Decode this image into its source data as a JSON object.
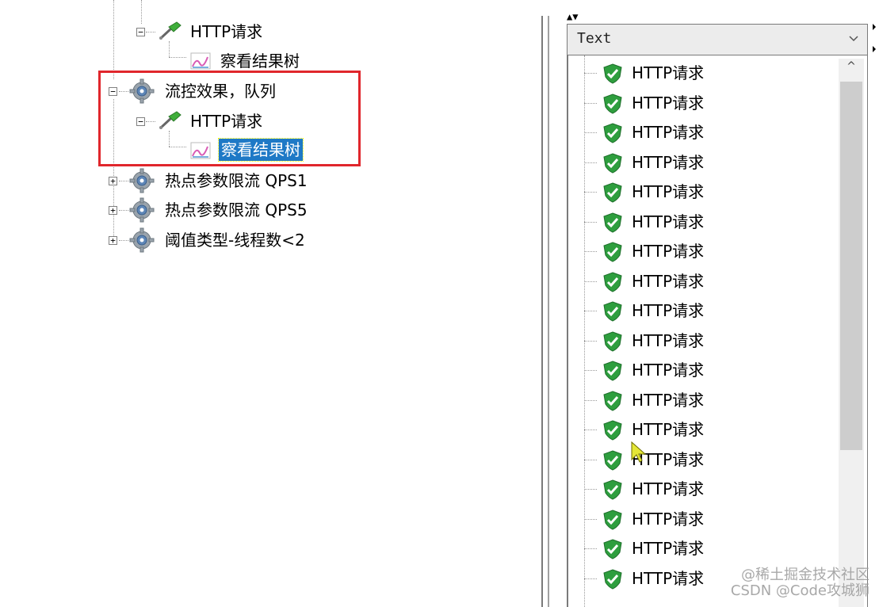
{
  "tree": {
    "nodes": [
      {
        "label": "HTTP请求",
        "type": "sampler",
        "expanded": true
      },
      {
        "label": "察看结果树",
        "type": "listener"
      },
      {
        "label": "流控效果，队列",
        "type": "thread-group",
        "expanded": true
      },
      {
        "label": "HTTP请求",
        "type": "sampler",
        "expanded": true
      },
      {
        "label": "察看结果树",
        "type": "listener",
        "selected": true
      },
      {
        "label": "热点参数限流 QPS1",
        "type": "thread-group",
        "expanded": false
      },
      {
        "label": "热点参数限流 QPS5",
        "type": "thread-group",
        "expanded": false
      },
      {
        "label": "阈值类型-线程数<2",
        "type": "thread-group",
        "expanded": false
      }
    ],
    "toggle_expanded": "−",
    "toggle_collapsed": "+",
    "highlight_color": "#e0262c",
    "selection_color": "#1e79c6"
  },
  "results_panel": {
    "renderer_select": {
      "value": "Text"
    },
    "top_marks": "▲▼",
    "results": [
      "HTTP请求",
      "HTTP请求",
      "HTTP请求",
      "HTTP请求",
      "HTTP请求",
      "HTTP请求",
      "HTTP请求",
      "HTTP请求",
      "HTTP请求",
      "HTTP请求",
      "HTTP请求",
      "HTTP请求",
      "HTTP请求",
      "HTTP请求",
      "HTTP请求",
      "HTTP请求",
      "HTTP请求",
      "HTTP请求"
    ],
    "result_icon": "success-shield-icon",
    "success_color": "#2e9e3e",
    "scroll_up_label": "^"
  },
  "watermark": {
    "line1": "@稀土掘金技术社区",
    "line2": "CSDN @Code攻城狮"
  }
}
